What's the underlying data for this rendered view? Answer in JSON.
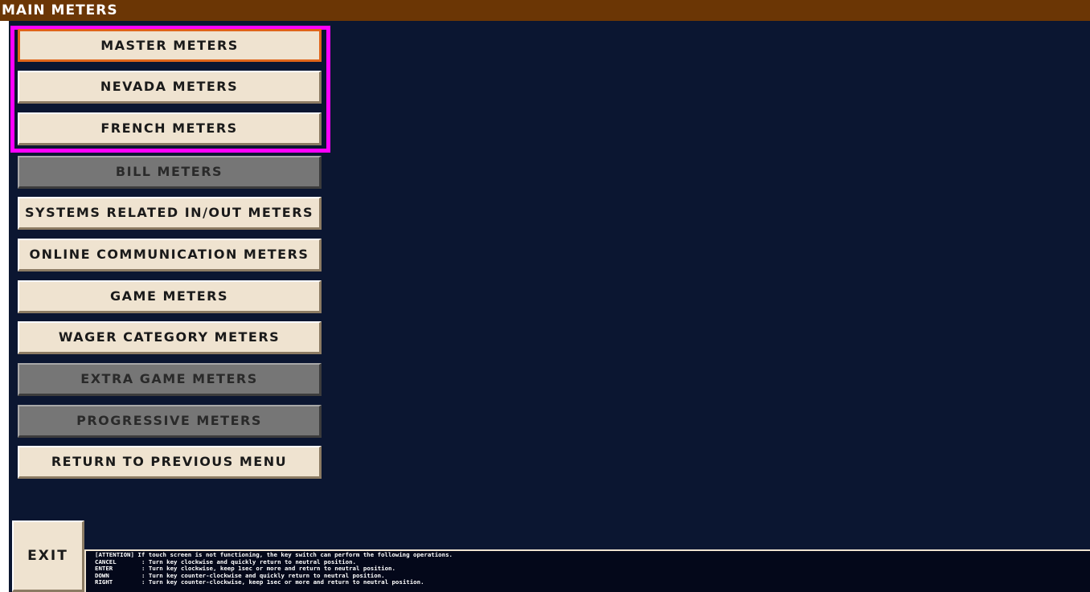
{
  "title": "MAIN METERS",
  "menu": [
    {
      "label": "MASTER METERS",
      "state": "selected"
    },
    {
      "label": "NEVADA METERS",
      "state": "enabled"
    },
    {
      "label": "FRENCH METERS",
      "state": "enabled"
    },
    {
      "label": "BILL METERS",
      "state": "disabled"
    },
    {
      "label": "SYSTEMS RELATED IN/OUT METERS",
      "state": "enabled"
    },
    {
      "label": "ONLINE COMMUNICATION METERS",
      "state": "enabled"
    },
    {
      "label": "GAME METERS",
      "state": "enabled"
    },
    {
      "label": "WAGER CATEGORY METERS",
      "state": "enabled"
    },
    {
      "label": "EXTRA GAME METERS",
      "state": "disabled"
    },
    {
      "label": "PROGRESSIVE METERS",
      "state": "disabled"
    },
    {
      "label": "RETURN TO PREVIOUS MENU",
      "state": "enabled"
    }
  ],
  "exit_label": "EXIT",
  "info": {
    "attention_key": "[ATTENTION]",
    "attention_text": "If touch screen is not functioning, the key switch can perform the following operations.",
    "lines": [
      {
        "key": "CANCEL",
        "text": ": Turn key clockwise and quickly return to neutral position."
      },
      {
        "key": "ENTER",
        "text": ": Turn key clockwise, keep 1sec or more and return to neutral position."
      },
      {
        "key": "DOWN",
        "text": ": Turn key counter-clockwise and quickly return to neutral position."
      },
      {
        "key": "RIGHT",
        "text": ": Turn key counter-clockwise, keep 1sec or more and return to neutral position."
      }
    ]
  },
  "colors": {
    "title_bar": "#6b3605",
    "background": "#0b1631",
    "button": "#efe3d0",
    "button_disabled": "#767676",
    "selected_border": "#e0651a",
    "group_highlight": "#ff00ff"
  }
}
